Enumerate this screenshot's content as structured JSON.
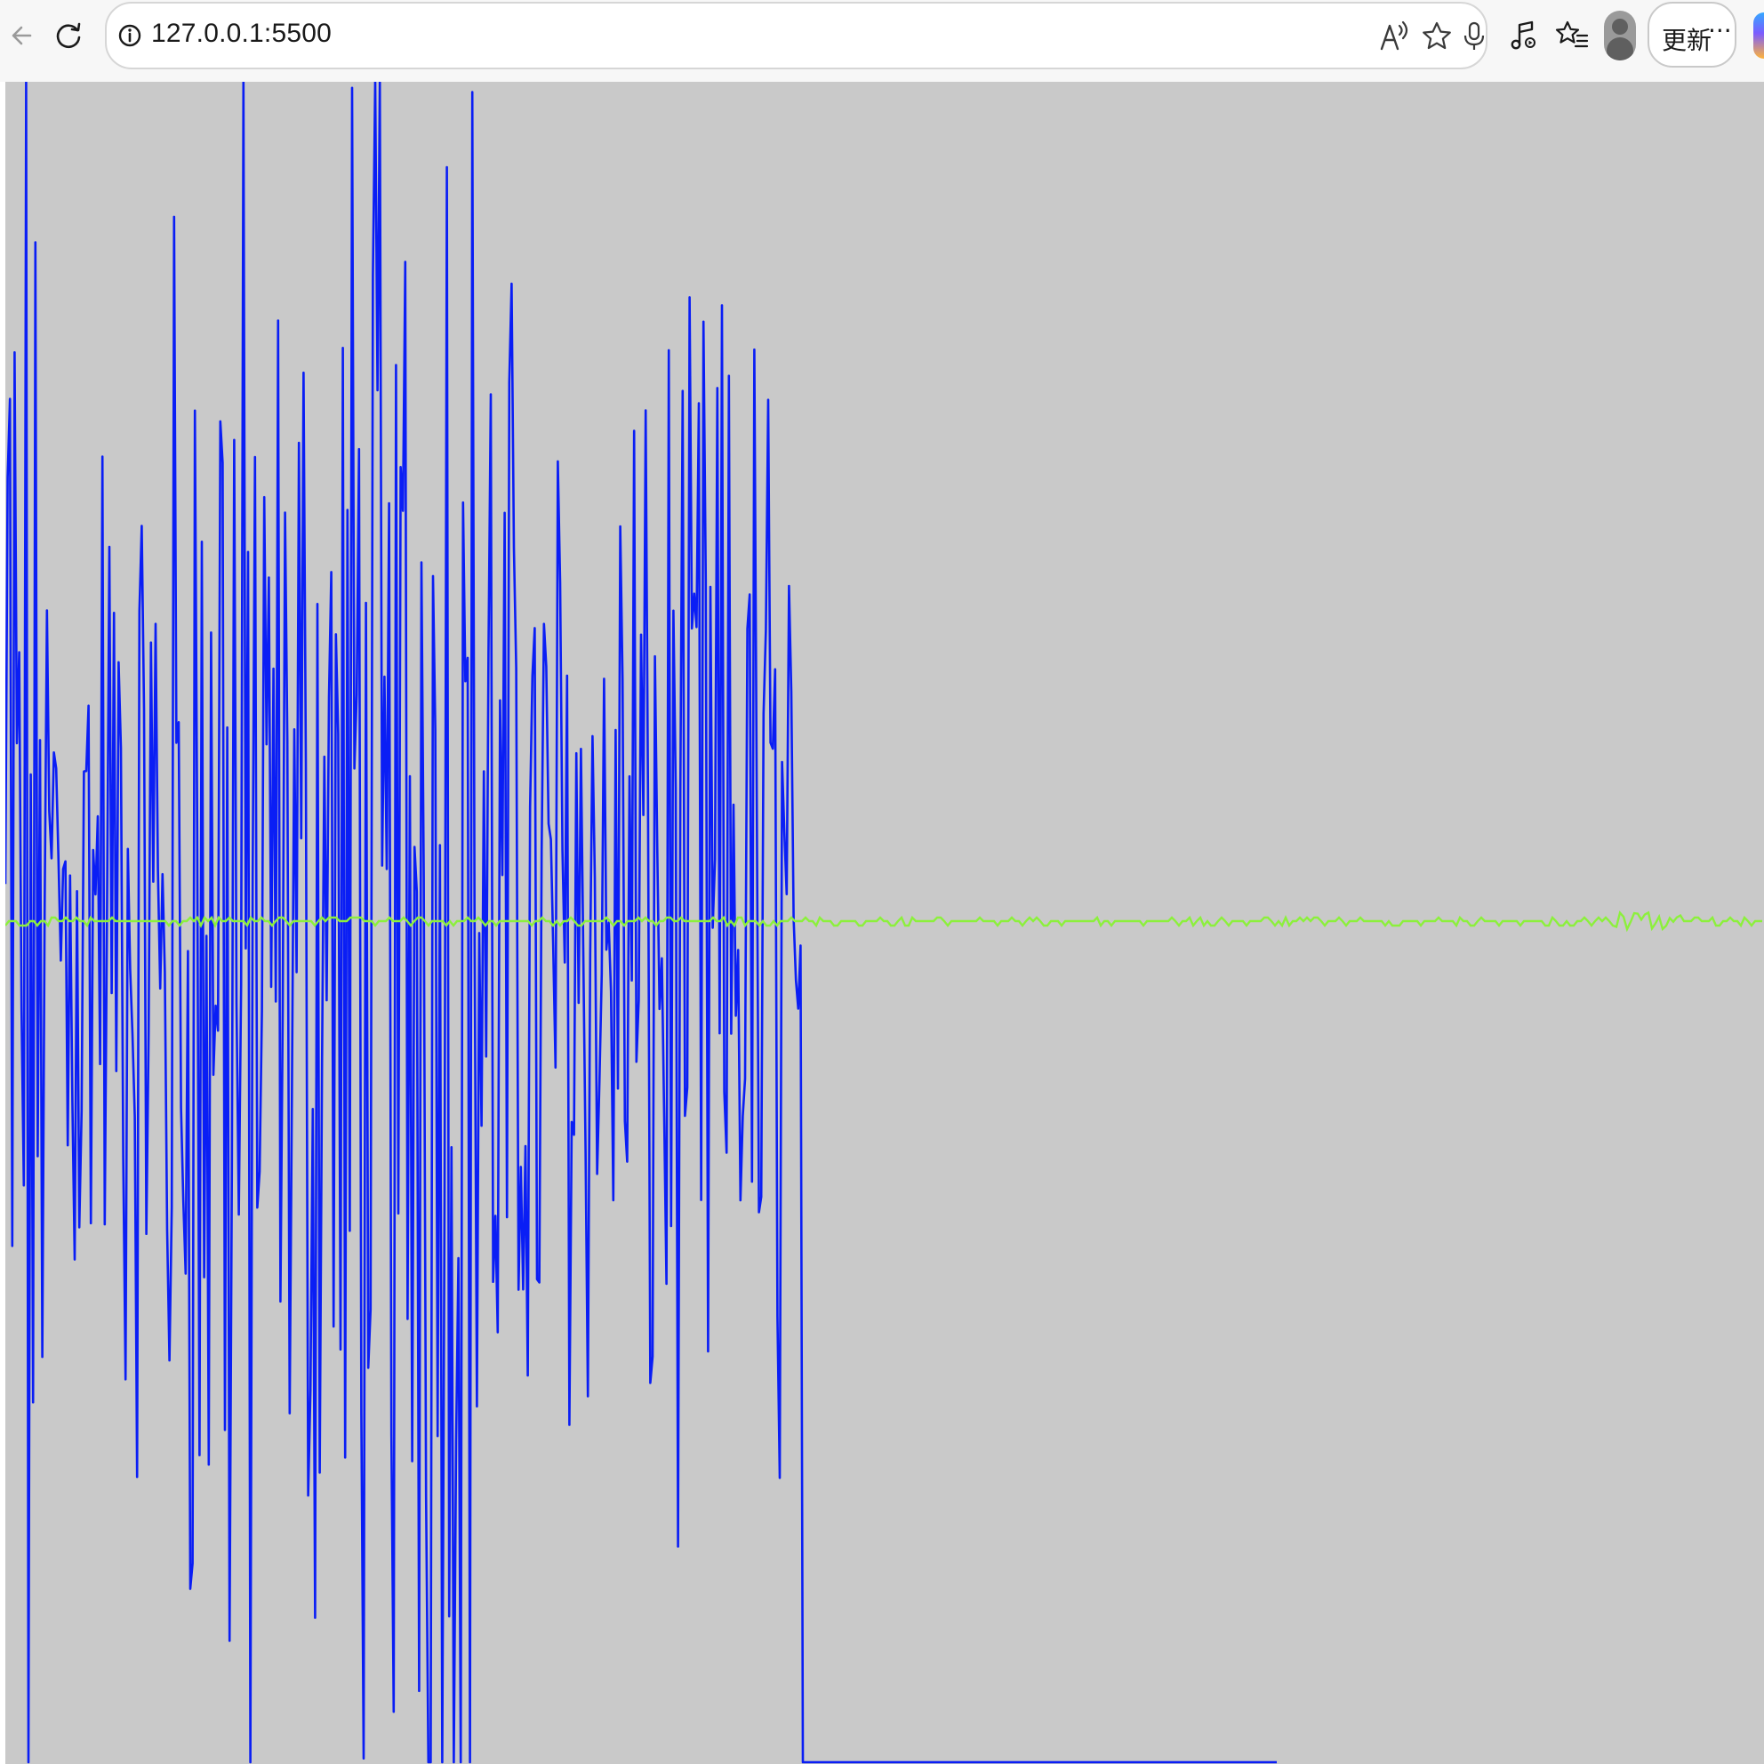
{
  "browser": {
    "address_bar": {
      "url": "127.0.0.1:5500"
    },
    "update_button": {
      "label": "更新",
      "more_label": "···"
    },
    "icons": {
      "back": "back-arrow-icon",
      "refresh": "refresh-icon",
      "site_info": "info-icon",
      "read_aloud": "read-aloud-icon",
      "favorite": "star-icon",
      "voice": "microphone-icon",
      "media": "music-note-icon",
      "favorites_list": "favorites-icon",
      "profile": "profile-avatar-icon",
      "copilot": "copilot-icon"
    }
  },
  "canvas": {
    "background": "#c9c9c9",
    "waveform_color": "#0a1ef5",
    "trace_color": "#8cf03c"
  }
}
